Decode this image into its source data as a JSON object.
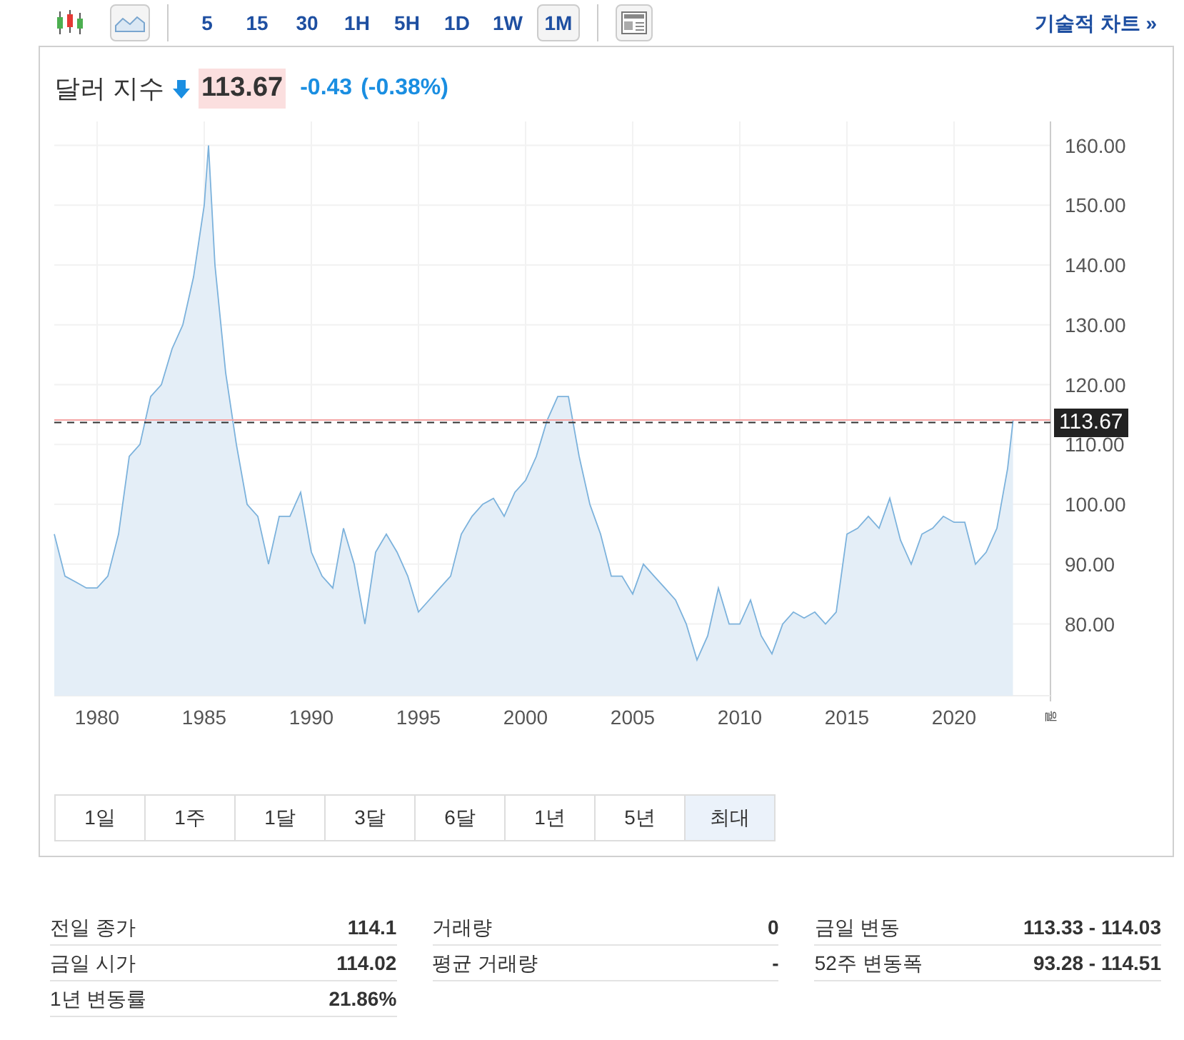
{
  "toolbar": {
    "chart_types": [
      {
        "kind": "candlestick",
        "selected": false
      },
      {
        "kind": "area",
        "selected": true
      }
    ],
    "intervals": [
      {
        "label": "5",
        "selected": false
      },
      {
        "label": "15",
        "selected": false
      },
      {
        "label": "30",
        "selected": false
      },
      {
        "label": "1H",
        "selected": false
      },
      {
        "label": "5H",
        "selected": false
      },
      {
        "label": "1D",
        "selected": false
      },
      {
        "label": "1W",
        "selected": false
      },
      {
        "label": "1M",
        "selected": true
      }
    ],
    "link": "기술적 차트 »"
  },
  "header": {
    "name": "달러 지수",
    "falling": true,
    "price": "113.67",
    "change": "-0.43",
    "change_percent": "(-0.38%)"
  },
  "chart": {
    "axis_unit": "월",
    "chart_data": {
      "type": "area",
      "grid": true,
      "xlim": [
        1978,
        2024.5
      ],
      "ylim": [
        68,
        164
      ],
      "ref_lines": [
        {
          "axis": "y",
          "value": 114.1,
          "color": "#f5a3a3"
        },
        {
          "axis": "y",
          "value": 113.67,
          "label": "113.67",
          "color": "#333333"
        }
      ],
      "xticks": [
        1980,
        1985,
        1990,
        1995,
        2000,
        2005,
        2010,
        2015,
        2020
      ],
      "yticks": [
        {
          "value": 80,
          "label": "80.00"
        },
        {
          "value": 90,
          "label": "90.00"
        },
        {
          "value": 100,
          "label": "100.00"
        },
        {
          "value": 110,
          "label": "110.00"
        },
        {
          "value": 120,
          "label": "120.00"
        },
        {
          "value": 130,
          "label": "130.00"
        },
        {
          "value": 140,
          "label": "140.00"
        },
        {
          "value": 150,
          "label": "150.00"
        },
        {
          "value": 160,
          "label": "160.00"
        }
      ],
      "x": [
        1978,
        1978.5,
        1979,
        1979.5,
        1980,
        1980.5,
        1981,
        1981.5,
        1982,
        1982.5,
        1983,
        1983.5,
        1984,
        1984.5,
        1985,
        1985.2,
        1985.5,
        1986,
        1986.5,
        1987,
        1987.5,
        1988,
        1988.5,
        1989,
        1989.5,
        1990,
        1990.5,
        1991,
        1991.5,
        1992,
        1992.5,
        1993,
        1993.5,
        1994,
        1994.5,
        1995,
        1995.5,
        1996,
        1996.5,
        1997,
        1997.5,
        1998,
        1998.5,
        1999,
        1999.5,
        2000,
        2000.5,
        2001,
        2001.5,
        2002,
        2002.5,
        2003,
        2003.5,
        2004,
        2004.5,
        2005,
        2005.5,
        2006,
        2006.5,
        2007,
        2007.5,
        2008,
        2008.5,
        2009,
        2009.5,
        2010,
        2010.5,
        2011,
        2011.5,
        2012,
        2012.5,
        2013,
        2013.5,
        2014,
        2014.5,
        2015,
        2015.5,
        2016,
        2016.5,
        2017,
        2017.5,
        2018,
        2018.5,
        2019,
        2019.5,
        2020,
        2020.5,
        2021,
        2021.5,
        2022,
        2022.5,
        2022.75
      ],
      "series": [
        {
          "color": "#7cb2dc",
          "values": [
            95,
            88,
            87,
            86,
            86,
            88,
            95,
            108,
            110,
            118,
            120,
            126,
            130,
            138,
            150,
            160,
            140,
            122,
            110,
            100,
            98,
            90,
            98,
            98,
            102,
            92,
            88,
            86,
            96,
            90,
            80,
            92,
            95,
            92,
            88,
            82,
            84,
            86,
            88,
            95,
            98,
            100,
            101,
            98,
            102,
            104,
            108,
            114,
            118,
            118,
            108,
            100,
            95,
            88,
            88,
            85,
            90,
            88,
            86,
            84,
            80,
            74,
            78,
            86,
            80,
            80,
            84,
            78,
            75,
            80,
            82,
            81,
            82,
            80,
            82,
            95,
            96,
            98,
            96,
            101,
            94,
            90,
            95,
            96,
            98,
            97,
            97,
            90,
            92,
            96,
            106,
            114
          ]
        }
      ]
    }
  },
  "ranges": [
    {
      "label": "1일",
      "selected": false
    },
    {
      "label": "1주",
      "selected": false
    },
    {
      "label": "1달",
      "selected": false
    },
    {
      "label": "3달",
      "selected": false
    },
    {
      "label": "6달",
      "selected": false
    },
    {
      "label": "1년",
      "selected": false
    },
    {
      "label": "5년",
      "selected": false
    },
    {
      "label": "최대",
      "selected": true
    }
  ],
  "stats": [
    [
      {
        "label": "전일 종가",
        "value": "114.1"
      },
      {
        "label": "금일 시가",
        "value": "114.02"
      },
      {
        "label": "1년 변동률",
        "value": "21.86%"
      }
    ],
    [
      {
        "label": "거래량",
        "value": "0"
      },
      {
        "label": "평균 거래량",
        "value": "-"
      }
    ],
    [
      {
        "label": "금일 변동",
        "value": "113.33 - 114.03"
      },
      {
        "label": "52주 변동폭",
        "value": "93.28 - 114.51"
      }
    ]
  ]
}
